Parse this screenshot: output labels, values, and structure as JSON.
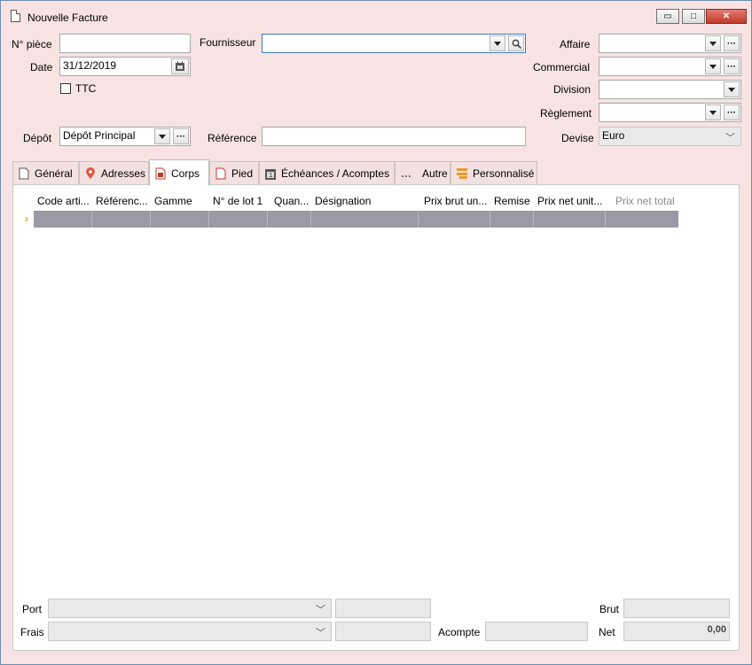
{
  "window": {
    "title": "Nouvelle Facture",
    "controls": {
      "minimize": "▭",
      "maximize": "□",
      "close": "✕"
    }
  },
  "header": {
    "num_piece_label": "N° pièce",
    "num_piece_value": "",
    "date_label": "Date",
    "date_value": "31/12/2019",
    "ttc_label": "TTC",
    "depot_label": "Dépôt",
    "depot_value": "Dépôt Principal",
    "fournisseur_label": "Fournisseur",
    "fournisseur_value": "",
    "reference_label": "Référence",
    "reference_value": "",
    "affaire_label": "Affaire",
    "commercial_label": "Commercial",
    "division_label": "Division",
    "reglement_label": "Règlement",
    "devise_label": "Devise",
    "devise_value": "Euro"
  },
  "tabs": [
    {
      "label": "Général",
      "icon": "document-icon"
    },
    {
      "label": "Adresses",
      "icon": "map-pin-icon"
    },
    {
      "label": "Corps",
      "icon": "document-red-icon",
      "active": true
    },
    {
      "label": "Pied",
      "icon": "document-icon"
    },
    {
      "label": "Échéances / Acomptes",
      "icon": "calendar-icon"
    },
    {
      "label": "Autre",
      "icon": "ellipsis-icon"
    },
    {
      "label": "Personnalisé",
      "icon": "custom-fields-icon"
    }
  ],
  "grid": {
    "columns": [
      "Code arti...",
      "Référenc...",
      "Gamme",
      "N° de lot 1",
      "Quan...",
      "Désignation",
      "Prix brut un...",
      "Remise",
      "Prix net unit...",
      "Prix net total"
    ],
    "row_marker": "›"
  },
  "footer": {
    "port_label": "Port",
    "frais_label": "Frais",
    "acompte_label": "Acompte",
    "brut_label": "Brut",
    "net_label": "Net",
    "net_value": "0,00"
  },
  "colors": {
    "window_bg": "#f7e3e3",
    "selected_row": "#9a9aa6",
    "accent": "#3c7fb1"
  }
}
